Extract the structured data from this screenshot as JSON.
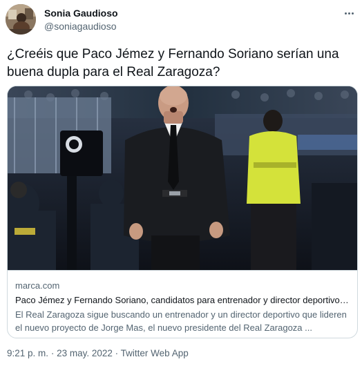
{
  "author": {
    "display_name": "Sonia Gaudioso",
    "handle": "@soniagaudioso"
  },
  "tweet": {
    "text": "¿Creéis que Paco Jémez y Fernando Soriano serían una buena dupla para el Real Zaragoza?"
  },
  "link_card": {
    "domain": "marca.com",
    "title": "Paco Jémez y Fernando Soriano, candidatos para entrenador y director deportivo del Real Zaragoza",
    "description": "El Real Zaragoza sigue buscando un entrenador y un director deportivo que lideren el nuevo proyecto de Jorge Mas, el nuevo presidente del Real Zaragoza ..."
  },
  "metadata": {
    "time": "9:21 p. m.",
    "separator": "·",
    "date": "23 may. 2022",
    "source": "Twitter Web App"
  },
  "icons": {
    "more": "more-options-icon"
  },
  "colors": {
    "text_primary": "#0f1419",
    "text_secondary": "#536471",
    "border": "#cfd9de"
  }
}
